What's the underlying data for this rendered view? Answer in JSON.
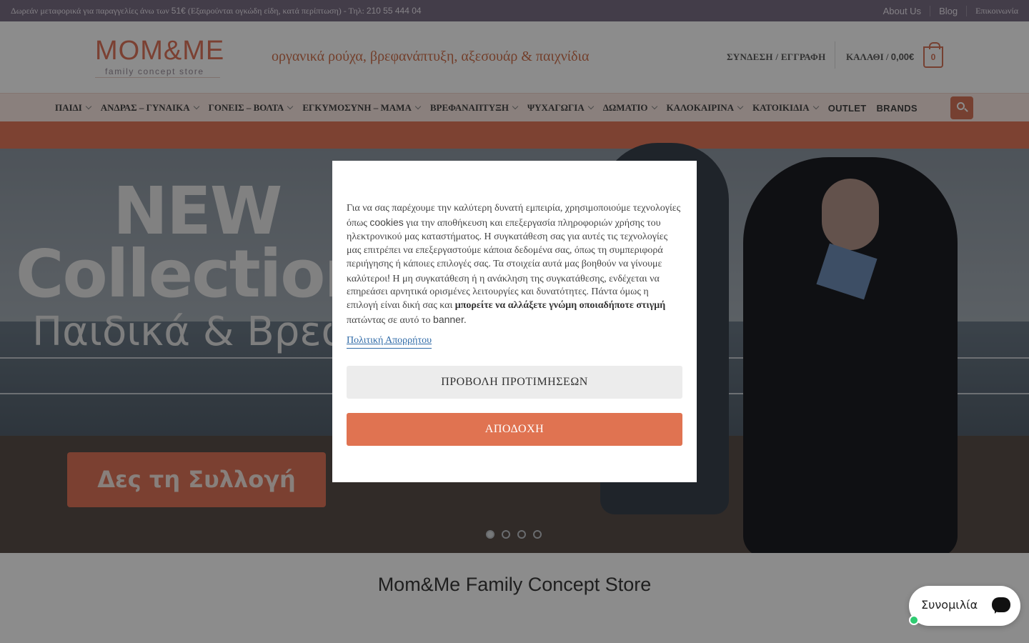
{
  "topbar": {
    "message_prefix": "Δωρεάν μεταφορικά για παραγγελίες άνω των ",
    "message_amount": "51€",
    "message_mid": " (Εξαιρούνται ογκώδη είδη, κατά περίπτωση) - Τηλ: ",
    "message_phone": "210 55 444 04",
    "links": [
      "About Us",
      "Blog",
      "Επικοινωνία"
    ]
  },
  "header": {
    "logo_word": "MOM&ME",
    "logo_sub": "family concept store",
    "tagline": "οργανικά ρούχα, βρεφανάπτυξη, αξεσουάρ & παιχνίδια",
    "account_label": "ΣΥΝΔΕΣΗ / ΕΓΓΡΑΦΗ",
    "cart_label": "ΚΑΛΑΘΙ / ",
    "cart_amount": "0,00€",
    "cart_count": "0"
  },
  "nav": {
    "items": [
      {
        "label": "ΠΑΙΔΙ"
      },
      {
        "label": "ΑΝΔΡΑΣ – ΓΥΝΑΙΚΑ"
      },
      {
        "label": "ΓΟΝΕΙΣ – ΒΟΛΤΑ"
      },
      {
        "label": "ΕΓΚΥΜΟΣΥΝΗ – ΜΑΜΑ"
      },
      {
        "label": "ΒΡΕΦΑΝΑΠΤΥΞΗ"
      },
      {
        "label": "ΨΥΧΑΓΩΓΙΑ"
      },
      {
        "label": "ΔΩΜΑΤΙΟ"
      },
      {
        "label": "ΚΑΛΟΚΑΙΡΙΝΑ"
      },
      {
        "label": "ΚΑΤΟΙΚΙΔΙΑ"
      },
      {
        "label": "OUTLET"
      },
      {
        "label": "BRANDS"
      }
    ]
  },
  "hero": {
    "line1": "NEW",
    "line2": "Collection",
    "line3": "Παιδικά & Βρεφικά",
    "cta": "Δες τη Συλλογή",
    "slide_count": 4,
    "active_slide": 1
  },
  "modal": {
    "text_a": "Για να σας παρέχουμε την καλύτερη δυνατή εμπειρία, χρησιμοποιούμε τεχνολογίες όπως ",
    "text_cookies": "cookies",
    "text_b": " για την αποθήκευση και επεξεργασία πληροφοριών χρήσης του ηλεκτρονικού μας καταστήματος. Η συγκατάθεση σας για αυτές τις τεχνολογίες μας επιτρέπει να επεξεργαστούμε κάποια δεδομένα σας, όπως τη συμπεριφορά περιήγησης ή κάποιες επιλογές σας. Τα στοιχεία αυτά μας βοηθούν να γίνουμε καλύτεροι",
    "text_excl": "!",
    "text_c": " Η μη συγκατάθεση ή η ανάκληση της συγκατάθεσης, ενδέχεται να επηρεάσει αρνητικά ορισμένες λειτουργίες και δυνατότητες. Πάντα όμως η επιλογή είναι δική σας και ",
    "text_bold": "μπορείτε να αλλάξετε γνώμη οποιαδήποτε στιγμή",
    "text_d": " πατώντας σε αυτό το ",
    "text_banner": "banner.",
    "policy_link": "Πολιτική Απορρήτου",
    "preferences_button": "ΠΡΟΒΟΛΗ ΠΡΟΤΙΜΗΣΕΩΝ",
    "accept_button": "ΑΠΟΔΟΧΗ"
  },
  "section_title": "Mom&Me Family Concept Store",
  "chat": {
    "label": "Συνομιλία"
  },
  "colors": {
    "accent": "#e07351",
    "topbar": "#7a6f86",
    "nav_bg": "#fbe9e4",
    "link": "#2f6aa7"
  }
}
